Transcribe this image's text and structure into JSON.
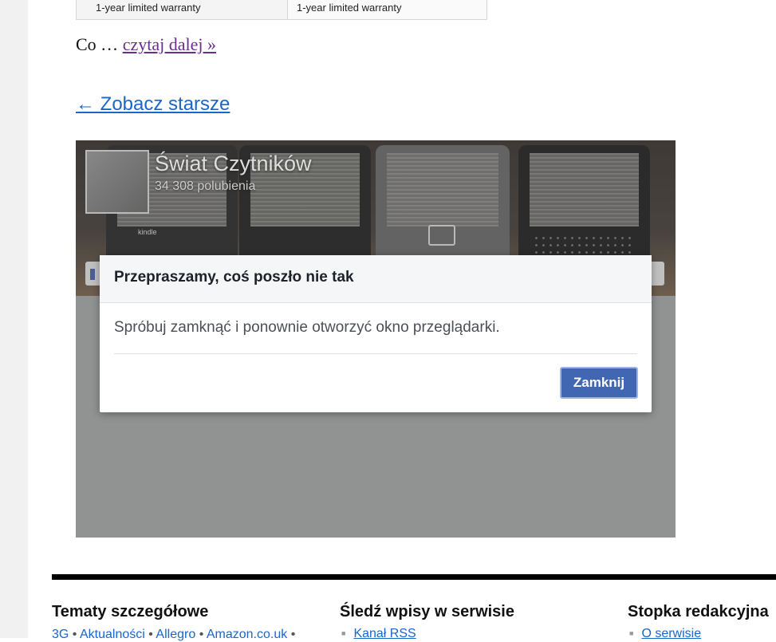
{
  "spec_table": {
    "cell_left": "1-year limited warranty",
    "cell_right": "1-year limited warranty"
  },
  "excerpt": {
    "prefix": "Co …",
    "read_more": "czytaj dalej »"
  },
  "navigation": {
    "older_posts": "← Zobacz starsze"
  },
  "fb_widget": {
    "page_name": "Świat Czytników",
    "likes": "34 308 polubienia",
    "kindle_brand": "kindle"
  },
  "dialog": {
    "title": "Przepraszamy, coś poszło nie tak",
    "message": "Spróbuj zamknąć i ponownie otworzyć okno przeglądarki.",
    "close_label": "Zamknij",
    "button_color": "#4267b2"
  },
  "footer": {
    "topics": {
      "title": "Tematy szczegółowe",
      "tags": [
        "3G",
        "Aktualności",
        "Allegro",
        "Amazon.co.uk"
      ],
      "separator": "•"
    },
    "follow": {
      "title": "Śledź wpisy w serwisie",
      "items": [
        "Kanał RSS"
      ]
    },
    "imprint": {
      "title": "Stopka redakcyjna",
      "items": [
        "O serwisie"
      ]
    }
  }
}
